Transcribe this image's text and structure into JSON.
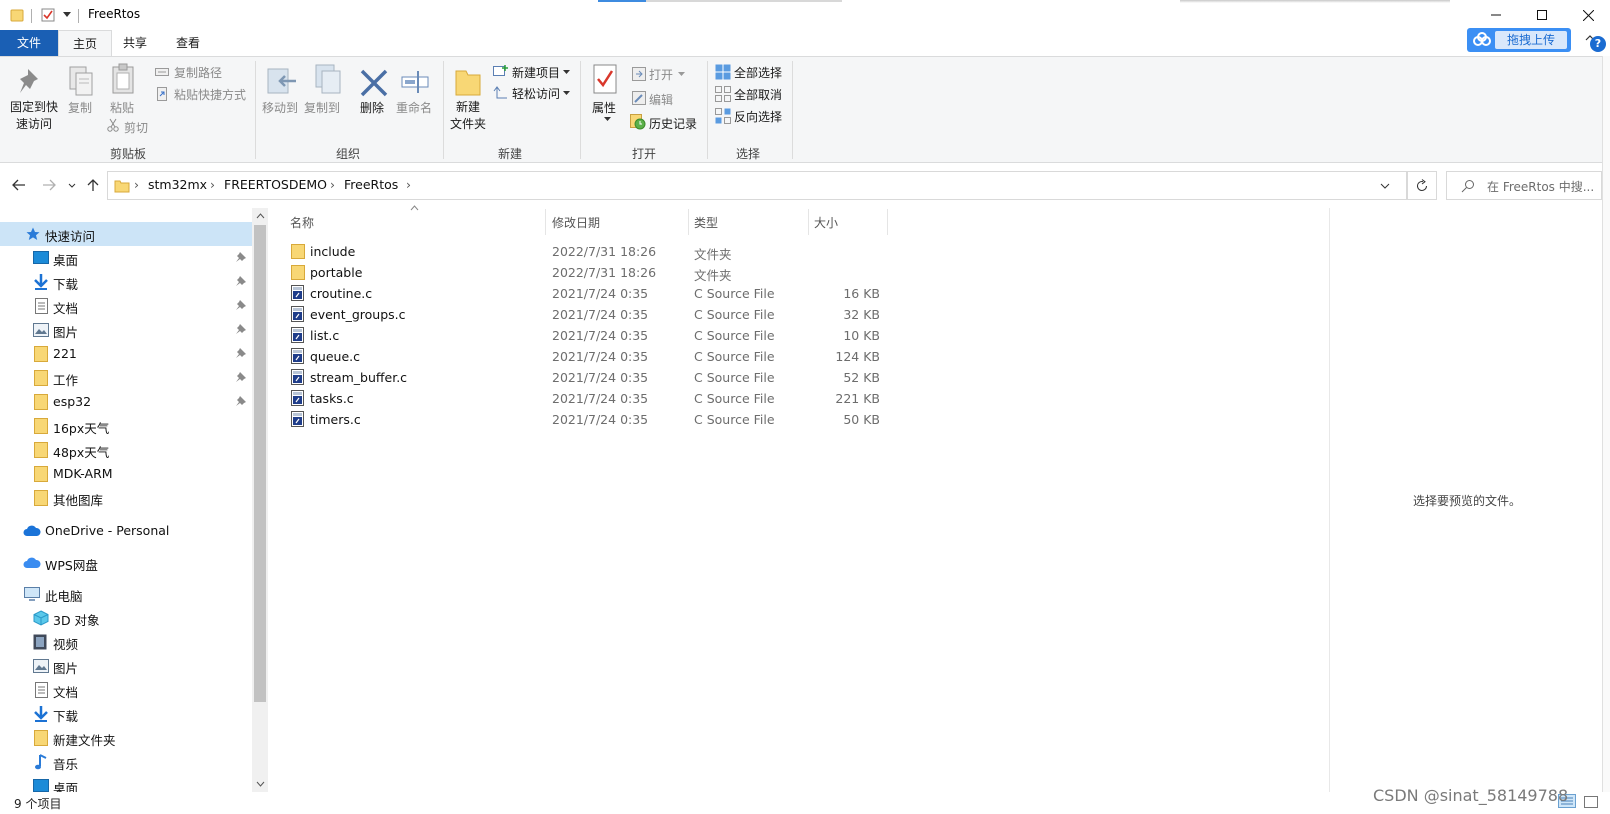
{
  "window": {
    "title": "FreeRtos"
  },
  "ribbon_tabs": [
    "文件",
    "主页",
    "共享",
    "查看"
  ],
  "upload_label": "拖拽上传",
  "ribbon": {
    "clipboard": {
      "pin": "固定到快\n速访问",
      "copy": "复制",
      "paste": "粘贴",
      "copy_path": "复制路径",
      "paste_shortcut": "粘贴快捷方式",
      "cut": "剪切",
      "group": "剪贴板"
    },
    "organize": {
      "move_to": "移动到",
      "copy_to": "复制到",
      "delete": "删除",
      "rename": "重命名",
      "group": "组织"
    },
    "new": {
      "new_folder": "新建\n文件夹",
      "new_item": "新建项目",
      "easy_access": "轻松访问",
      "group": "新建"
    },
    "open": {
      "properties": "属性",
      "open": "打开",
      "edit": "编辑",
      "history": "历史记录",
      "group": "打开"
    },
    "select": {
      "select_all": "全部选择",
      "select_none": "全部取消",
      "invert": "反向选择",
      "group": "选择"
    }
  },
  "address": {
    "crumbs": [
      "stm32mx",
      "FREERTOSDEMO",
      "FreeRtos"
    ],
    "search_placeholder": "在 FreeRtos 中搜..."
  },
  "nav": {
    "quick_access": "快速访问",
    "quick_items": [
      "桌面",
      "下载",
      "文档",
      "图片",
      "221",
      "工作",
      "esp32",
      "16px天气",
      "48px天气",
      "MDK-ARM",
      "其他图库"
    ],
    "onedrive": "OneDrive - Personal",
    "wps": "WPS网盘",
    "this_pc": "此电脑",
    "pc_items": [
      "3D 对象",
      "视频",
      "图片",
      "文档",
      "下载",
      "新建文件夹",
      "音乐",
      "桌面"
    ]
  },
  "columns": {
    "name": "名称",
    "date": "修改日期",
    "type": "类型",
    "size": "大小"
  },
  "files": [
    {
      "name": "include",
      "date": "2022/7/31 18:26",
      "type": "文件夹",
      "size": "",
      "kind": "folder"
    },
    {
      "name": "portable",
      "date": "2022/7/31 18:26",
      "type": "文件夹",
      "size": "",
      "kind": "folder"
    },
    {
      "name": "croutine.c",
      "date": "2021/7/24 0:35",
      "type": "C Source File",
      "size": "16 KB",
      "kind": "c"
    },
    {
      "name": "event_groups.c",
      "date": "2021/7/24 0:35",
      "type": "C Source File",
      "size": "32 KB",
      "kind": "c"
    },
    {
      "name": "list.c",
      "date": "2021/7/24 0:35",
      "type": "C Source File",
      "size": "10 KB",
      "kind": "c"
    },
    {
      "name": "queue.c",
      "date": "2021/7/24 0:35",
      "type": "C Source File",
      "size": "124 KB",
      "kind": "c"
    },
    {
      "name": "stream_buffer.c",
      "date": "2021/7/24 0:35",
      "type": "C Source File",
      "size": "52 KB",
      "kind": "c"
    },
    {
      "name": "tasks.c",
      "date": "2021/7/24 0:35",
      "type": "C Source File",
      "size": "221 KB",
      "kind": "c"
    },
    {
      "name": "timers.c",
      "date": "2021/7/24 0:35",
      "type": "C Source File",
      "size": "50 KB",
      "kind": "c"
    }
  ],
  "preview_text": "选择要预览的文件。",
  "status": {
    "count": "9 个项目"
  },
  "watermark": "CSDN @sinat_58149788",
  "colors": {
    "accent": "#1a5fb4",
    "folder": "#f8d775",
    "selection": "#cce4f7"
  }
}
